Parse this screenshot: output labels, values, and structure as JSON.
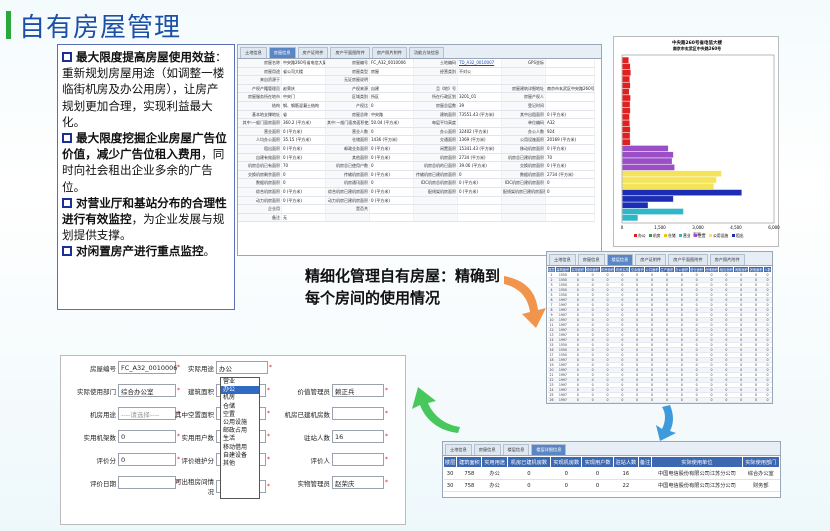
{
  "title": "自有房屋管理",
  "bullets": [
    {
      "bold": "最大限度提高房屋使用效益",
      "rest": "：重新规划房屋用途（如调整一楼临街机房及办公用房），让房产规划更加合理，实现利益最大化。"
    },
    {
      "bold": "最大限度挖掘企业房屋广告位价值，减少广告位租入费用",
      "rest": "，同时向社会租出企业多余的广告位。"
    },
    {
      "bold": "对营业厅和基站分布的合理性进行有效监控",
      "rest": "，为企业发展与规划提供支撑。"
    },
    {
      "bold": "对闲置房产进行重点监控",
      "rest": "。"
    }
  ],
  "middle_text": "精细化管理自有房屋：精确到每个房间的使用情况",
  "detail_form": {
    "tabs": [
      "土地信息",
      "房屋信息",
      "房产证附件",
      "房产平面图附件",
      "房产照片附件",
      "功能方块信息"
    ],
    "active_tab": 1,
    "cells": [
      "房屋名称",
      "中央路260号省电信大厦",
      "房屋编号",
      "FC_A32_0010006",
      "土地编码",
      "TD_A32_0010007",
      "GPS坐标",
      "",
      "房屋用途",
      "省公司大楼",
      "房屋类型",
      "房屋",
      "经营类别",
      "不对公",
      "",
      "",
      "来自资源于",
      "",
      "无证房屋说明",
      "",
      "",
      "",
      "",
      "",
      "产权产籍管理员",
      "赵荣庆",
      "产权来源",
      "自建",
      "且《地》号",
      "",
      "房屋建筑详细地址",
      "南京市玄武区中央路260号",
      "房屋服务所在地市",
      "中央门",
      "区域类别",
      "所区",
      "所在行政区划",
      "3201_01",
      "房屋产权人",
      "",
      "结构",
      "钢、钢筋混凝土结构",
      "产权比",
      "0",
      "房屋总层数",
      "39",
      "登记时间",
      "",
      "基本地支撑地址",
      "省",
      "房屋总称",
      "中央路",
      "建筑面积",
      "73551.43 (平方米)",
      "其中出租面积",
      "0 (平方米)",
      "其中:一般门面房面积",
      "360.2 (平方米)",
      "其中:一般门面房面积使用",
      "50.04 (平方米)",
      "每层平均高度",
      "",
      "单位编码",
      "A32",
      "营业面积",
      "0 (平方米)",
      "营业人数",
      "0",
      "办公面积",
      "32402 (平方米)",
      "办公人数",
      "924",
      "人均办公面积",
      "35.15 (平方米)",
      "仓储面积",
      "1436 (平方米)",
      "交通面积",
      "1369 (平方米)",
      "公用设施面积",
      "20169 (平方米)",
      "租出面积",
      "0 (平方米)",
      "邮政业务面积",
      "0 (平方米)",
      "闲置面积",
      "15341.43 (平方米)",
      "移动机房面积",
      "0 (平方米)",
      "自建有效面积",
      "0 (平方米)",
      "其他面积",
      "0 (平方米)",
      "机房面积",
      "2734 (平方米)",
      "机房总已建机房面积",
      "70",
      "机房总机已有面积",
      "70",
      "机房总已使用户数",
      "0",
      "机房总机的已面积",
      "39.06 (平方米)",
      "交换机房面积",
      "0 (平方米)",
      "交换机房剩余面积",
      "0",
      "传输机房面积",
      "0 (平方米)",
      "传输机房已建机房面积",
      "0",
      "数据机房面积",
      "2734 (平方米)",
      "数据机房面积",
      "0",
      "机房通讯面积",
      "0",
      "IDC机房总机房面积",
      "0 (平方米)",
      "IDC机房已建机房面积",
      "0",
      "综合机房面积",
      "0 (平方米)",
      "综合机房已建机房面积",
      "0 (平方米)",
      "配线架机房面积",
      "0 (平方米)",
      "配线架机房已建机房面积",
      "0",
      "动力机房面积",
      "0 (平方米)",
      "动力机房已建机房面积",
      "0 (平方米)",
      "",
      "",
      "",
      "",
      "企业用",
      "",
      "是否共",
      "",
      "",
      "",
      "",
      "",
      "备注",
      "无",
      "",
      "",
      "",
      "",
      "",
      ""
    ]
  },
  "chart_data": {
    "type": "bar",
    "title": "中央路260号省电信大楼",
    "subtitle": "南京市玄武区中央路260号",
    "xlabel": "面积",
    "xlim": [
      0,
      6000
    ],
    "x_ticks": [
      "0",
      "1,500",
      "3,000",
      "4,500",
      "6,000"
    ],
    "legend": [
      {
        "name": "办公",
        "color": "#e02020"
      },
      {
        "name": "机房",
        "color": "#2f9e3a"
      },
      {
        "name": "仓储",
        "color": "#f0c419"
      },
      {
        "name": "营业",
        "color": "#2fb7c9"
      },
      {
        "name": "空置",
        "color": "#9b4fc6"
      },
      {
        "name": "公用设施",
        "color": "#f5e35a"
      },
      {
        "name": "租出",
        "color": "#1b2db5"
      }
    ],
    "series_bars": [
      {
        "series": "办公",
        "values": [
          240,
          300,
          320,
          280,
          300,
          260,
          310,
          290,
          300,
          270,
          280,
          300,
          290,
          300
        ]
      },
      {
        "series": "空置",
        "values": [
          1800,
          2000,
          1950,
          2050
        ]
      },
      {
        "series": "公用设施",
        "values": [
          3900,
          3700,
          3600
        ]
      },
      {
        "series": "租出",
        "values": [
          4700,
          2000,
          1000
        ]
      },
      {
        "series": "营业",
        "values": [
          2400,
          600
        ]
      }
    ]
  },
  "room_table": {
    "tabs": [
      "土地信息",
      "房屋信息",
      "楼层信息",
      "房产证附件",
      "房产平面图附件",
      "房产照片附件"
    ],
    "headers": [
      "楼层",
      "建筑面积",
      "实用面积",
      "使用面积",
      "机房面积",
      "机房实用",
      "空余面积",
      "公共面积",
      "生产面积",
      "办公面积",
      "营业面积",
      "仓储面积",
      "租出面积",
      "闲置面积",
      "其他面积",
      "人数"
    ],
    "rows": [
      [
        "1",
        "1550",
        "0",
        "0",
        "0",
        "0",
        "0",
        "0",
        "0",
        "0",
        "0",
        "0",
        "0",
        "0",
        "0",
        "0"
      ],
      [
        "2",
        "1550",
        "0",
        "0",
        "0",
        "0",
        "0",
        "0",
        "0",
        "0",
        "0",
        "0",
        "0",
        "0",
        "0",
        "0"
      ],
      [
        "3",
        "1550",
        "0",
        "0",
        "0",
        "0",
        "0",
        "0",
        "0",
        "0",
        "0",
        "0",
        "0",
        "0",
        "0",
        "0"
      ],
      [
        "4",
        "1550",
        "0",
        "0",
        "0",
        "0",
        "0",
        "0",
        "0",
        "0",
        "0",
        "0",
        "0",
        "0",
        "0",
        "0"
      ],
      [
        "5",
        "1550",
        "0",
        "0",
        "0",
        "0",
        "0",
        "0",
        "0",
        "0",
        "0",
        "0",
        "0",
        "0",
        "0",
        "0"
      ],
      [
        "6",
        "1997",
        "0",
        "0",
        "0",
        "0",
        "0",
        "0",
        "0",
        "0",
        "0",
        "0",
        "0",
        "0",
        "0",
        "0"
      ],
      [
        "7",
        "1997",
        "0",
        "0",
        "0",
        "0",
        "0",
        "0",
        "0",
        "0",
        "0",
        "0",
        "0",
        "0",
        "0",
        "0"
      ],
      [
        "8",
        "1997",
        "0",
        "0",
        "0",
        "0",
        "0",
        "0",
        "0",
        "0",
        "0",
        "0",
        "0",
        "0",
        "0",
        "0"
      ],
      [
        "9",
        "1997",
        "0",
        "0",
        "0",
        "0",
        "0",
        "0",
        "0",
        "0",
        "0",
        "0",
        "0",
        "0",
        "0",
        "0"
      ],
      [
        "10",
        "1997",
        "0",
        "0",
        "0",
        "0",
        "0",
        "0",
        "0",
        "0",
        "0",
        "0",
        "0",
        "0",
        "0",
        "0"
      ],
      [
        "11",
        "1997",
        "0",
        "0",
        "0",
        "0",
        "0",
        "0",
        "0",
        "0",
        "0",
        "0",
        "0",
        "0",
        "0",
        "0"
      ],
      [
        "12",
        "1997",
        "0",
        "0",
        "0",
        "0",
        "0",
        "0",
        "0",
        "0",
        "0",
        "0",
        "0",
        "0",
        "0",
        "0"
      ],
      [
        "13",
        "1997",
        "0",
        "0",
        "0",
        "0",
        "0",
        "0",
        "0",
        "0",
        "0",
        "0",
        "0",
        "0",
        "0",
        "0"
      ],
      [
        "14",
        "1997",
        "0",
        "0",
        "0",
        "0",
        "0",
        "0",
        "0",
        "0",
        "0",
        "0",
        "0",
        "0",
        "0",
        "0"
      ],
      [
        "15",
        "1550",
        "0",
        "0",
        "0",
        "0",
        "0",
        "0",
        "0",
        "0",
        "0",
        "0",
        "0",
        "0",
        "0",
        "0"
      ],
      [
        "16",
        "1550",
        "0",
        "0",
        "0",
        "0",
        "0",
        "0",
        "0",
        "0",
        "0",
        "0",
        "0",
        "0",
        "0",
        "0"
      ],
      [
        "17",
        "1550",
        "0",
        "0",
        "0",
        "0",
        "0",
        "0",
        "0",
        "0",
        "0",
        "0",
        "0",
        "0",
        "0",
        "0"
      ],
      [
        "18",
        "1997",
        "0",
        "0",
        "0",
        "0",
        "0",
        "0",
        "0",
        "0",
        "0",
        "0",
        "0",
        "0",
        "0",
        "0"
      ],
      [
        "19",
        "1997",
        "0",
        "0",
        "0",
        "0",
        "0",
        "0",
        "0",
        "0",
        "0",
        "0",
        "0",
        "0",
        "0",
        "0"
      ],
      [
        "20",
        "1997",
        "0",
        "0",
        "0",
        "0",
        "0",
        "0",
        "0",
        "0",
        "0",
        "0",
        "0",
        "0",
        "0",
        "0"
      ],
      [
        "21",
        "1997",
        "0",
        "0",
        "0",
        "0",
        "0",
        "0",
        "0",
        "0",
        "0",
        "0",
        "0",
        "0",
        "0",
        "0"
      ],
      [
        "22",
        "1997",
        "0",
        "0",
        "0",
        "0",
        "0",
        "0",
        "0",
        "0",
        "0",
        "0",
        "0",
        "0",
        "0",
        "0"
      ],
      [
        "23",
        "1997",
        "0",
        "0",
        "0",
        "0",
        "0",
        "0",
        "0",
        "0",
        "0",
        "0",
        "0",
        "0",
        "0",
        "0"
      ],
      [
        "24",
        "1997",
        "0",
        "0",
        "0",
        "0",
        "0",
        "0",
        "0",
        "0",
        "0",
        "0",
        "0",
        "0",
        "0",
        "0"
      ],
      [
        "25",
        "1997",
        "0",
        "0",
        "0",
        "0",
        "0",
        "0",
        "0",
        "0",
        "0",
        "0",
        "0",
        "0",
        "0",
        "0"
      ],
      [
        "26",
        "1997",
        "0",
        "0",
        "0",
        "0",
        "0",
        "0",
        "0",
        "0",
        "0",
        "0",
        "0",
        "0",
        "0",
        "0"
      ]
    ]
  },
  "bottom_form": {
    "fields": [
      {
        "label": "房屋编号",
        "value": "FC_A32_0010006"
      },
      {
        "label": "实际使用部门",
        "value": "综合办公室"
      },
      {
        "label": "机房用途",
        "value": "----请选择----"
      },
      {
        "label": "实用机架数",
        "value": "0"
      },
      {
        "label": "评价分",
        "value": "0"
      },
      {
        "label": "评价日期",
        "value": ""
      },
      {
        "label": "实际用途",
        "value": "办公"
      },
      {
        "label": "建筑面积",
        "value": ""
      },
      {
        "label": "其中空置面积",
        "value": ""
      },
      {
        "label": "实用用户数",
        "value": ""
      },
      {
        "label": "评价维护分",
        "value": ""
      },
      {
        "label": "可出租房间情况",
        "value": ""
      },
      {
        "label": "价值管理员",
        "value": "赖正兵"
      },
      {
        "label": "机房已建机房数",
        "value": ""
      },
      {
        "label": "驻站人数",
        "value": "16"
      },
      {
        "label": "评价人",
        "value": ""
      },
      {
        "label": "实物管理员",
        "value": "赵荣庆"
      }
    ],
    "dropdown_options": [
      "营业",
      "办公",
      "机房",
      "仓储",
      "空置",
      "公用设施",
      "邮政占用",
      "生活",
      "移动借用",
      "自建设备",
      "其他"
    ],
    "dropdown_selected": "办公"
  },
  "floor_table": {
    "tabs": [
      "土地信息",
      "房屋信息",
      "楼层信息",
      "楼层详细信息"
    ],
    "headers": [
      "楼层",
      "建筑面积",
      "实用用途",
      "机房已建机房数",
      "实现机房数",
      "实现用户数",
      "驻站人数",
      "备注",
      "实际使用单位",
      "实际使用部门"
    ],
    "rows": [
      [
        "30",
        "758",
        "办公",
        "0",
        "0",
        "0",
        "16",
        "",
        "中国电信股份有限公司江苏分公司",
        "综合办公室"
      ],
      [
        "30",
        "758",
        "办公",
        "0",
        "0",
        "0",
        "22",
        "",
        "中国电信股份有限公司江苏分公司",
        "财务部"
      ]
    ]
  },
  "colors": {
    "title_blue": "#1c4fa7",
    "accent_green": "#2aa839",
    "table_header": "#3c67b1",
    "arrow_orange": "#f08a3a",
    "arrow_green": "#35c24a",
    "arrow_blue": "#2b8fd8"
  }
}
